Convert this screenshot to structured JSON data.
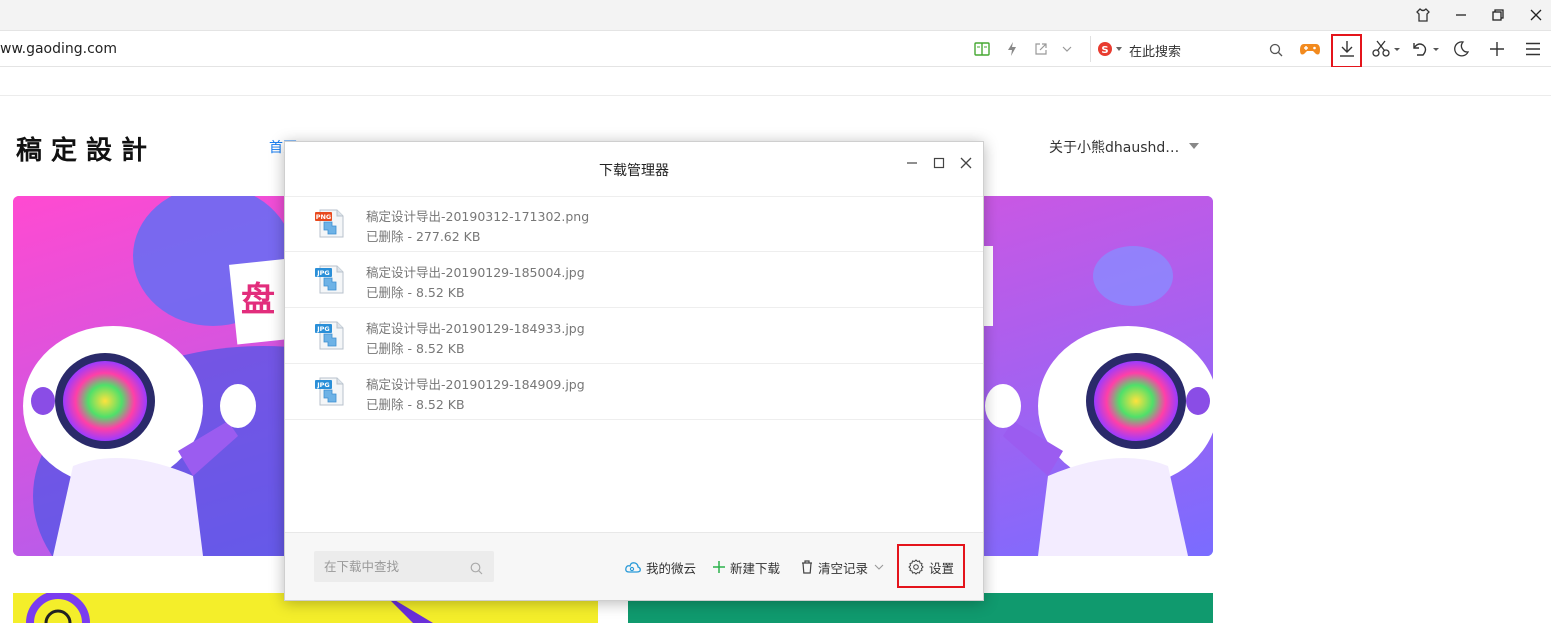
{
  "browser": {
    "url": "ww.gaoding.com",
    "search_placeholder": "在此搜索",
    "window_controls": [
      "skin-icon",
      "minimize-icon",
      "restore-icon",
      "close-icon"
    ]
  },
  "site": {
    "logo": "稿定設計",
    "nav_home": "首页",
    "user_menu": "关于小熊dhaushd…"
  },
  "download_manager": {
    "title": "下载管理器",
    "items": [
      {
        "name": "稿定设计导出-20190312-171302.png",
        "status": "已删除 - 277.62 KB",
        "type": "PNG",
        "type_color": "#e8491d"
      },
      {
        "name": "稿定设计导出-20190129-185004.jpg",
        "status": "已删除 - 8.52 KB",
        "type": "JPG",
        "type_color": "#2a8fd8"
      },
      {
        "name": "稿定设计导出-20190129-184933.jpg",
        "status": "已删除 - 8.52 KB",
        "type": "JPG",
        "type_color": "#2a8fd8"
      },
      {
        "name": "稿定设计导出-20190129-184909.jpg",
        "status": "已删除 - 8.52 KB",
        "type": "JPG",
        "type_color": "#2a8fd8"
      }
    ],
    "search_placeholder": "在下载中查找",
    "footer": {
      "weiyun": "我的微云",
      "new_download": "新建下载",
      "clear": "清空记录",
      "settings": "设置"
    }
  },
  "colors": {
    "highlight": "#e4141b",
    "link_blue": "#1a7ef0",
    "new_download_green": "#2bb24c"
  }
}
